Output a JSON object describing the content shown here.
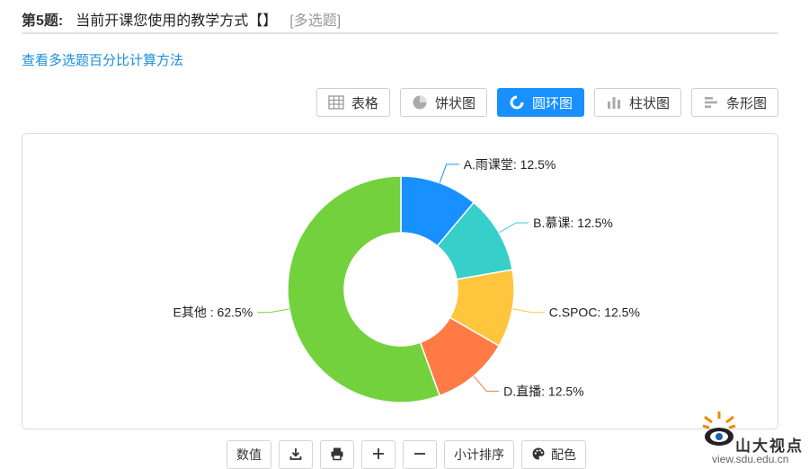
{
  "question": {
    "number": "第5题:",
    "text": "当前开课您使用的教学方式【】",
    "type": "[多选题]"
  },
  "calc_link": "查看多选题百分比计算方法",
  "view_tabs": [
    {
      "label": "表格",
      "icon": "table-icon",
      "active": false
    },
    {
      "label": "饼状图",
      "icon": "pie-chart-icon",
      "active": false
    },
    {
      "label": "圆环图",
      "icon": "donut-chart-icon",
      "active": true
    },
    {
      "label": "柱状图",
      "icon": "bar-chart-icon",
      "active": false
    },
    {
      "label": "条形图",
      "icon": "horizontal-bar-icon",
      "active": false
    }
  ],
  "bottom_tools": {
    "values_label": "数值",
    "download_icon": "download-icon",
    "print_icon": "print-icon",
    "zoom_in_icon": "plus-icon",
    "zoom_out_icon": "minus-icon",
    "sort_label": "小计排序",
    "color_label": "配色",
    "color_icon": "palette-icon"
  },
  "watermark": {
    "text": "山大视点",
    "url": "view.sdu.edu.cn"
  },
  "chart_data": {
    "type": "pie",
    "variant": "donut",
    "slices": [
      {
        "label": "A.雨课堂: 12.5%",
        "value": 12.5,
        "color": "#1890ff"
      },
      {
        "label": "B.慕课: 12.5%",
        "value": 12.5,
        "color": "#36cfc9"
      },
      {
        "label": "C.SPOC: 12.5%",
        "value": 12.5,
        "color": "#ffc53d"
      },
      {
        "label": "D.直播: 12.5%",
        "value": 12.5,
        "color": "#ff7a45"
      },
      {
        "label": "E其他 : 62.5%",
        "value": 62.5,
        "color": "#73d13d"
      }
    ],
    "start_angle_deg": 0,
    "direction": "clockwise"
  }
}
